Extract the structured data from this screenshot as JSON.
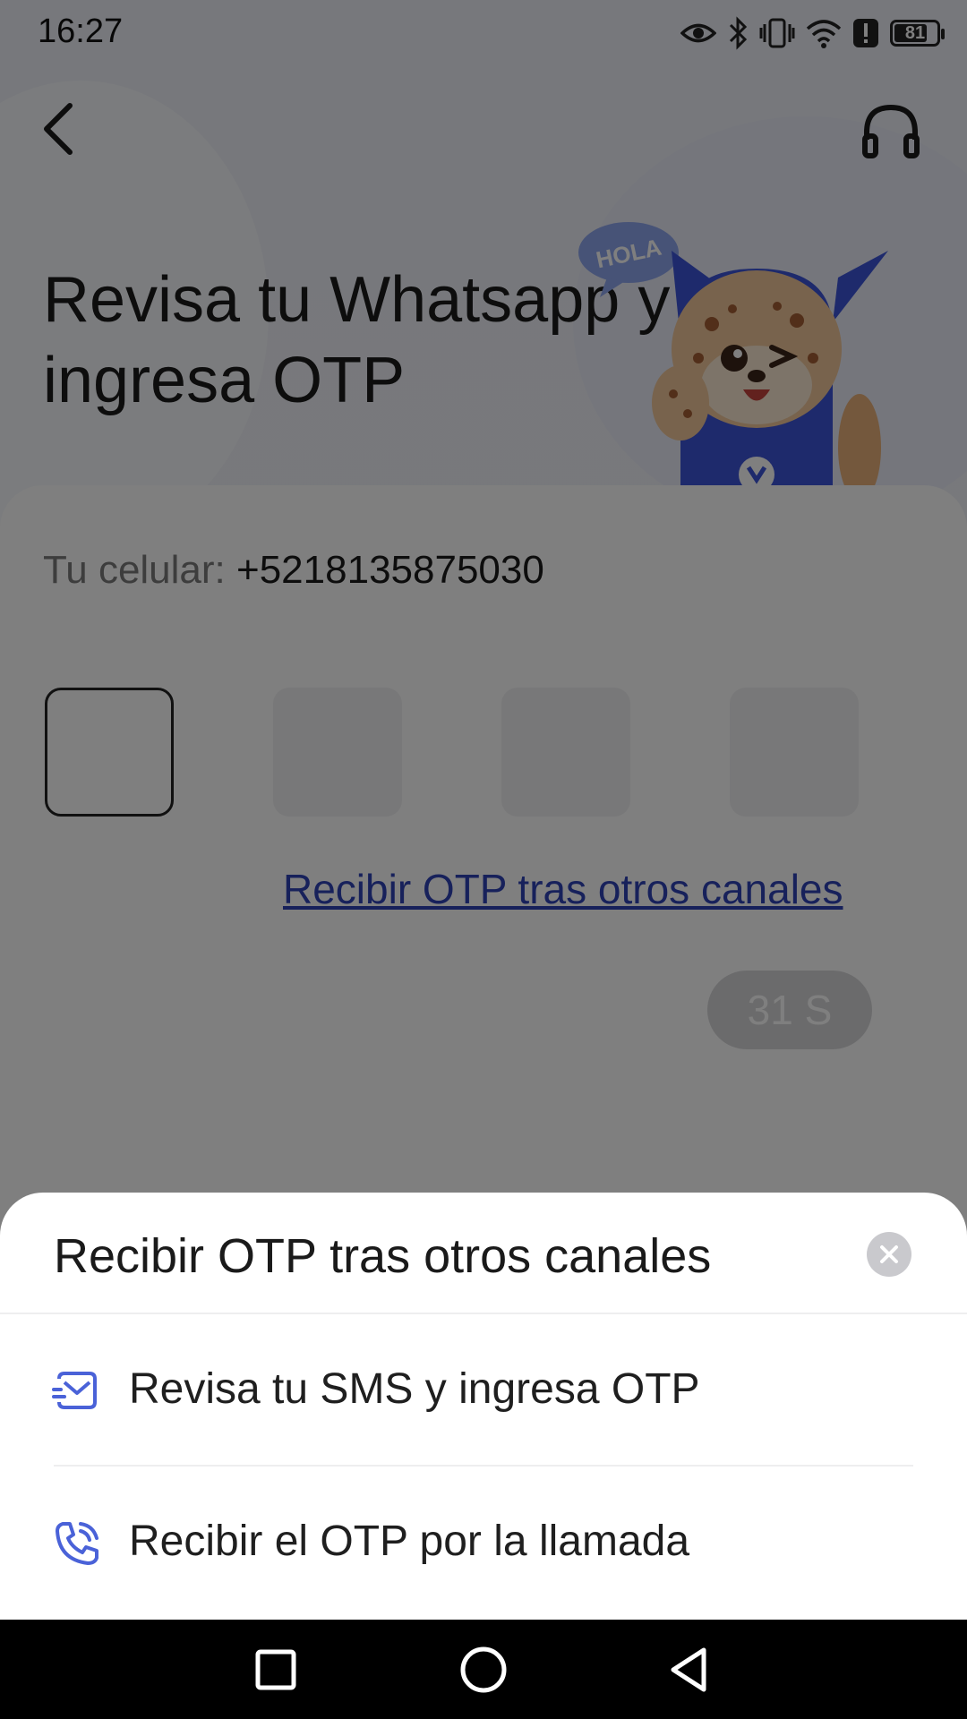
{
  "status_bar": {
    "time": "16:27",
    "battery_level": "81",
    "icons": [
      "eye-icon",
      "bluetooth-icon",
      "vibrate-icon",
      "wifi-icon",
      "alert-icon",
      "battery-icon"
    ]
  },
  "header": {
    "back_icon": "chevron-left-icon",
    "support_icon": "headset-icon",
    "title": "Revisa tu Whatsapp y ingresa OTP",
    "mascot_bubble": "HOLA"
  },
  "form": {
    "phone_label": "Tu celular:",
    "phone_number": "+5218135875030",
    "otp_length": 4,
    "other_channels_link": "Recibir OTP tras otros canales",
    "resend_timer": "31 S"
  },
  "bottom_sheet": {
    "title": "Recibir OTP tras otros canales",
    "options": [
      {
        "icon": "sms-icon",
        "label": "Revisa tu SMS y ingresa OTP"
      },
      {
        "icon": "phone-call-icon",
        "label": "Recibir el OTP por la llamada"
      }
    ]
  },
  "colors": {
    "accent": "#2f42b6",
    "icon_blue": "#4a62d8",
    "overlay": "rgba(0,0,0,0.5)"
  },
  "nav_bar": {
    "buttons": [
      "recents-button",
      "home-button",
      "back-button"
    ]
  }
}
